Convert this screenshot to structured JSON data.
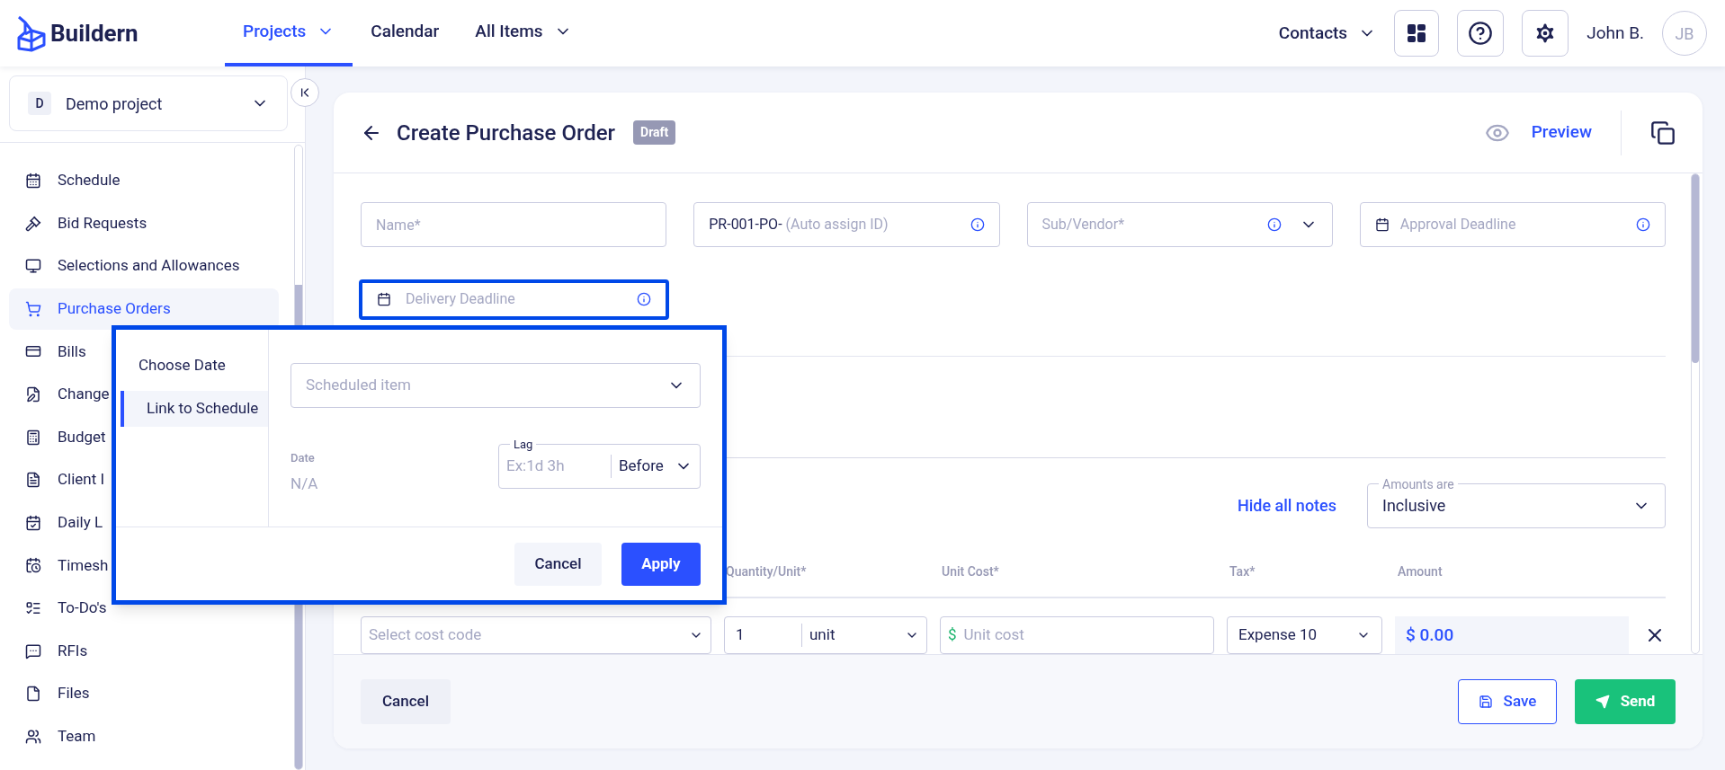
{
  "topbar": {
    "logo": "Buildern",
    "tabs": [
      {
        "label": "Projects",
        "selected": true,
        "menu": true
      },
      {
        "label": "Calendar",
        "selected": false,
        "menu": false
      },
      {
        "label": "All Items",
        "selected": false,
        "menu": true
      }
    ],
    "contacts": "Contacts",
    "user": "John B.",
    "initials": "JB"
  },
  "sidebar": {
    "project": {
      "badge": "D",
      "name": "Demo project"
    },
    "items": [
      {
        "label": "Schedule",
        "selected": false
      },
      {
        "label": "Bid Requests",
        "selected": false
      },
      {
        "label": "Selections and Allowances",
        "selected": false
      },
      {
        "label": "Purchase Orders",
        "selected": true
      },
      {
        "label": "Bills",
        "selected": false
      },
      {
        "label": "Change",
        "selected": false
      },
      {
        "label": "Budget",
        "selected": false
      },
      {
        "label": "Client I",
        "selected": false
      },
      {
        "label": "Daily L",
        "selected": false
      },
      {
        "label": "Timesh",
        "selected": false
      },
      {
        "label": "To-Do's",
        "selected": false
      },
      {
        "label": "RFIs",
        "selected": false
      },
      {
        "label": "Files",
        "selected": false
      },
      {
        "label": "Team",
        "selected": false
      }
    ]
  },
  "header": {
    "title": "Create Purchase Order",
    "status": "Draft",
    "preview": "Preview"
  },
  "fields": [
    {
      "kind": "text",
      "placeholder": "Name*"
    },
    {
      "kind": "id",
      "prefix": "PR-001-PO-",
      "placeholder": "(Auto assign ID)"
    },
    {
      "kind": "select",
      "placeholder": "Sub/Vendor*"
    },
    {
      "kind": "date",
      "placeholder": "Approval Deadline"
    }
  ],
  "delivery": {
    "placeholder": "Delivery Deadline",
    "highlighted": true
  },
  "notes_link": "Hide all notes",
  "amounts": {
    "label": "Amounts are",
    "value": "Inclusive"
  },
  "columns": [
    "Quantity/Unit*",
    "Unit Cost*",
    "Tax*",
    "Amount"
  ],
  "row": {
    "cost_code": "Select cost code",
    "quantity": "1",
    "unit": "unit",
    "currency": "$",
    "unit_cost": "Unit cost",
    "tax": "Expense 10",
    "amount": "$ 0.00"
  },
  "footer": {
    "cancel": "Cancel",
    "save": "Save",
    "send": "Send"
  },
  "popup": {
    "highlighted": true,
    "tabs": [
      {
        "label": "Choose Date",
        "selected": false
      },
      {
        "label": "Link to Schedule",
        "selected": true
      }
    ],
    "scheduled": "Scheduled item",
    "date_label": "Date",
    "date_value": "N/A",
    "lag_label": "Lag",
    "lag_placeholder": "Ex:1d 3h",
    "direction": "Before",
    "cancel": "Cancel",
    "apply": "Apply"
  }
}
